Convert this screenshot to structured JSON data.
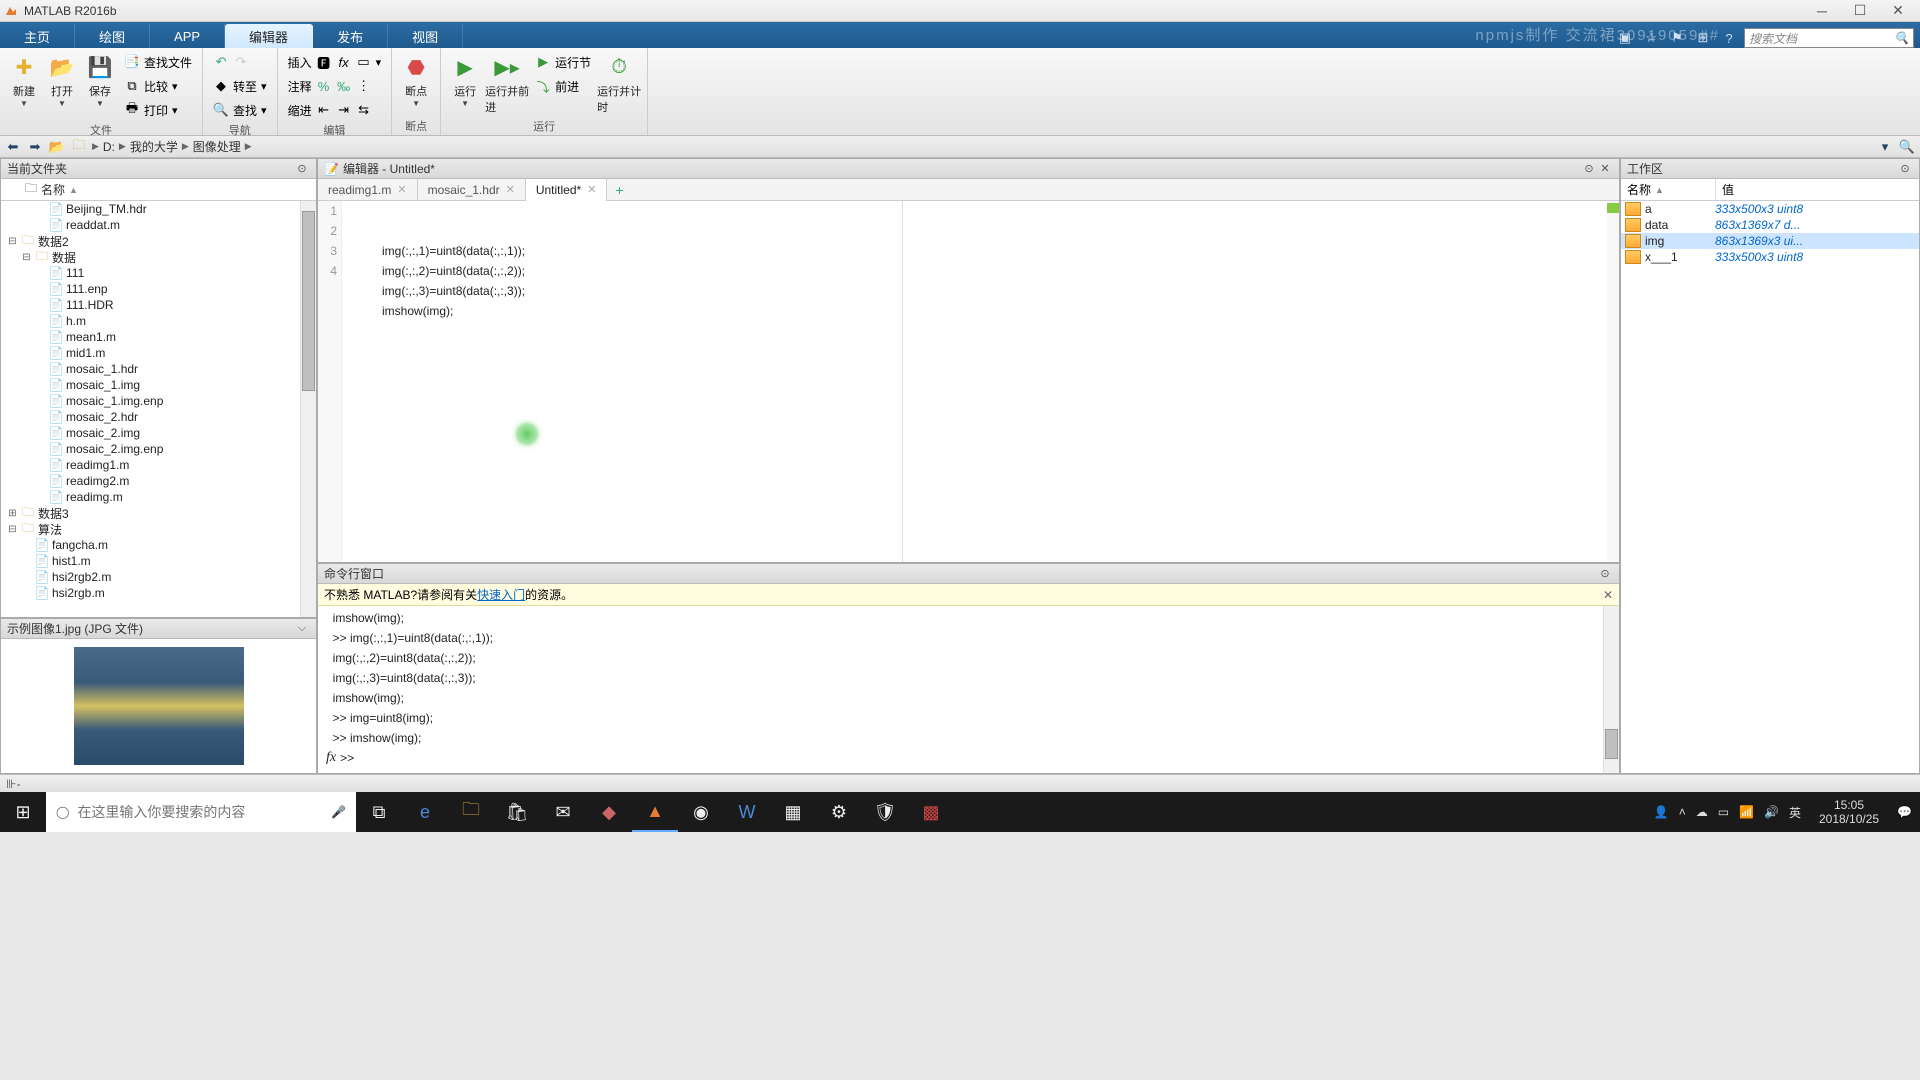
{
  "title": "MATLAB R2016b",
  "tabs": {
    "items": [
      "主页",
      "绘图",
      "APP",
      "编辑器",
      "发布",
      "视图"
    ],
    "active": 3
  },
  "search_placeholder": "搜索文档",
  "watermark": "npmjs制作  交流裙30919059##",
  "ribbon": {
    "groups": [
      {
        "label": "文件",
        "big": [
          {
            "label": "新建",
            "icon": "📄",
            "color": "#e8b030"
          },
          {
            "label": "打开",
            "icon": "📂",
            "color": "#d9a441"
          },
          {
            "label": "保存",
            "icon": "💾",
            "color": "#4a8ad9"
          }
        ],
        "mid": [
          {
            "label": "查找文件",
            "icon": "🔍"
          },
          {
            "label": "比较",
            "icon": "📊"
          },
          {
            "label": "打印",
            "icon": "🖨"
          }
        ]
      },
      {
        "label": "导航",
        "big": [],
        "mid": [
          {
            "label": "",
            "icon": "↩"
          },
          {
            "label": "转至",
            "icon": "◇"
          },
          {
            "label": "查找",
            "icon": "🔍"
          }
        ]
      },
      {
        "label": "编辑",
        "big": [
          {
            "label": "插入",
            "icon": ""
          },
          {
            "label": "注释",
            "icon": ""
          },
          {
            "label": "缩进",
            "icon": ""
          }
        ],
        "grid": [
          "🅵",
          "fx",
          "▾",
          "%",
          "‰",
          "⋮",
          "⇤",
          "⇥",
          "⇆"
        ]
      },
      {
        "label": "断点",
        "big": [
          {
            "label": "断点",
            "icon": "🔖",
            "color": "#d94a4a"
          }
        ]
      },
      {
        "label": "运行",
        "big": [
          {
            "label": "运行",
            "icon": "▶",
            "color": "#3a9a3a"
          },
          {
            "label": "运行并前进",
            "icon": "▶",
            "color": "#3a9a3a"
          }
        ],
        "small": [
          {
            "label": "运行节",
            "icon": "▶"
          },
          {
            "label": "前进",
            "icon": "⤵"
          }
        ],
        "big2": [
          {
            "label": "运行并计时",
            "icon": "⏱",
            "color": "#3a9a3a"
          }
        ]
      }
    ]
  },
  "path": {
    "drive": "D:",
    "segments": [
      "我的大学",
      "图像处理"
    ]
  },
  "filepanel": {
    "title": "当前文件夹",
    "name_header": "名称",
    "items": [
      {
        "name": "Beijing_TM.hdr",
        "depth": 2,
        "type": "file"
      },
      {
        "name": "readdat.m",
        "depth": 2,
        "type": "m"
      },
      {
        "name": "数据2",
        "depth": 0,
        "type": "folder",
        "expand": "−"
      },
      {
        "name": "数据",
        "depth": 1,
        "type": "folder",
        "expand": "−"
      },
      {
        "name": "111",
        "depth": 2,
        "type": "file"
      },
      {
        "name": "111.enp",
        "depth": 2,
        "type": "file"
      },
      {
        "name": "111.HDR",
        "depth": 2,
        "type": "file"
      },
      {
        "name": "h.m",
        "depth": 2,
        "type": "m"
      },
      {
        "name": "mean1.m",
        "depth": 2,
        "type": "m"
      },
      {
        "name": "mid1.m",
        "depth": 2,
        "type": "m"
      },
      {
        "name": "mosaic_1.hdr",
        "depth": 2,
        "type": "file"
      },
      {
        "name": "mosaic_1.img",
        "depth": 2,
        "type": "file"
      },
      {
        "name": "mosaic_1.img.enp",
        "depth": 2,
        "type": "file"
      },
      {
        "name": "mosaic_2.hdr",
        "depth": 2,
        "type": "file"
      },
      {
        "name": "mosaic_2.img",
        "depth": 2,
        "type": "file"
      },
      {
        "name": "mosaic_2.img.enp",
        "depth": 2,
        "type": "file"
      },
      {
        "name": "readimg1.m",
        "depth": 2,
        "type": "m"
      },
      {
        "name": "readimg2.m",
        "depth": 2,
        "type": "m"
      },
      {
        "name": "readimg.m",
        "depth": 2,
        "type": "m"
      },
      {
        "name": "数据3",
        "depth": 0,
        "type": "folder",
        "expand": "+"
      },
      {
        "name": "算法",
        "depth": 0,
        "type": "folder",
        "expand": "−"
      },
      {
        "name": "fangcha.m",
        "depth": 1,
        "type": "m"
      },
      {
        "name": "hist1.m",
        "depth": 1,
        "type": "m"
      },
      {
        "name": "hsi2rgb2.m",
        "depth": 1,
        "type": "m"
      },
      {
        "name": "hsi2rgb.m",
        "depth": 1,
        "type": "m"
      }
    ]
  },
  "preview": {
    "title": "示例图像1.jpg  (JPG 文件)"
  },
  "editor": {
    "title": "编辑器 - Untitled*",
    "tabs": [
      {
        "label": "readimg1.m",
        "active": false
      },
      {
        "label": "mosaic_1.hdr",
        "active": false
      },
      {
        "label": "Untitled*",
        "active": true
      }
    ],
    "lines": [
      "img(:,:,1)=uint8(data(:,:,1));",
      "img(:,:,2)=uint8(data(:,:,2));",
      "img(:,:,3)=uint8(data(:,:,3));",
      "imshow(img);"
    ]
  },
  "command": {
    "title": "命令行窗口",
    "tip_prefix": "不熟悉 MATLAB?请参阅有关",
    "tip_link": "快速入门",
    "tip_suffix": "的资源。",
    "lines": [
      "imshow(img);",
      ">> img(:,:,1)=uint8(data(:,:,1));",
      "img(:,:,2)=uint8(data(:,:,2));",
      "img(:,:,3)=uint8(data(:,:,3));",
      "imshow(img);",
      ">> img=uint8(img);",
      ">> imshow(img);"
    ],
    "prompt": ">>"
  },
  "workspace": {
    "title": "工作区",
    "cols": {
      "name": "名称",
      "value": "值"
    },
    "vars": [
      {
        "name": "a",
        "value": "333x500x3 uint8",
        "sel": false
      },
      {
        "name": "data",
        "value": "863x1369x7 d...",
        "sel": false
      },
      {
        "name": "img",
        "value": "863x1369x3 ui...",
        "sel": true
      },
      {
        "name": "x___1",
        "value": "333x500x3 uint8",
        "sel": false
      }
    ]
  },
  "taskbar": {
    "search_placeholder": "在这里输入你要搜索的内容",
    "ime": "英",
    "clock": {
      "time": "15:05",
      "date": "2018/10/25"
    }
  }
}
